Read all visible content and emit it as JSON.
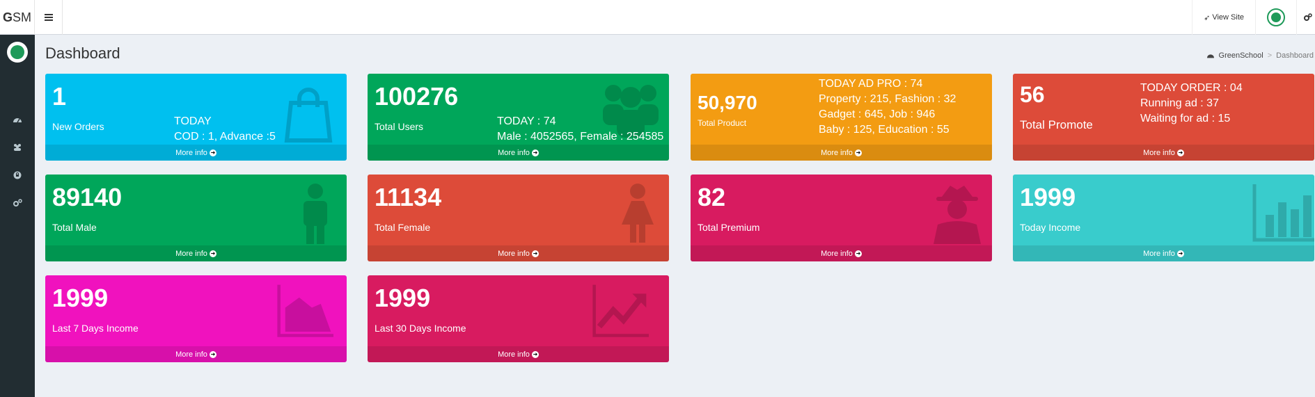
{
  "header": {
    "logo_bold": "G",
    "logo_rest": "SM",
    "view_site": "View Site"
  },
  "page": {
    "title": "Dashboard",
    "breadcrumb_home": "GreenSchool",
    "breadcrumb_active": "Dashboard"
  },
  "boxes": {
    "orders": {
      "number": "1",
      "label": "New Orders",
      "line1": "TODAY",
      "line2": "COD : 1, Advance :5",
      "more": "More info"
    },
    "users": {
      "number": "100276",
      "label": "Total Users",
      "line1": "TODAY : 74",
      "line2": "Male : 4052565, Female : 254585",
      "more": "More info"
    },
    "product": {
      "number": "50,970",
      "label": "Total Product",
      "line1": "TODAY AD PRO : 74",
      "line2": "Property : 215, Fashion : 32",
      "line3": "Gadget : 645, Job : 946",
      "line4": "Baby : 125,  Education : 55",
      "more": "More info"
    },
    "promote": {
      "number": "56",
      "label": "Total Promote",
      "line1": "TODAY ORDER : 04",
      "line2": "Running ad : 37",
      "line3": "Waiting for ad : 15",
      "more": "More info"
    },
    "male": {
      "number": "89140",
      "label": "Total Male",
      "more": "More info"
    },
    "female": {
      "number": "11134",
      "label": "Total Female",
      "more": "More info"
    },
    "premium": {
      "number": "82",
      "label": "Total Premium",
      "more": "More info"
    },
    "today_income": {
      "number": "1999",
      "label": "Today Income",
      "more": "More info"
    },
    "last7": {
      "number": "1999",
      "label": "Last 7 Days Income",
      "more": "More info"
    },
    "last30": {
      "number": "1999",
      "label": "Last 30 Days Income",
      "more": "More info"
    }
  },
  "colors": {
    "aqua": "#00c0ef",
    "green": "#00a65a",
    "orange": "#f39c12",
    "red": "#dd4b39",
    "maroon": "#d81b60",
    "teal": "#39cccc",
    "fuchsia": "#f012be",
    "sidebar": "#222d32"
  },
  "icons": {
    "sidebar": [
      "dashboard-icon",
      "users-icon",
      "lock-icon",
      "cogs-icon"
    ],
    "boxes": [
      "shopping-bag-icon",
      "users-icon",
      "male-icon",
      "female-icon",
      "user-secret-icon",
      "bar-chart-icon",
      "area-chart-icon",
      "line-chart-icon"
    ]
  }
}
